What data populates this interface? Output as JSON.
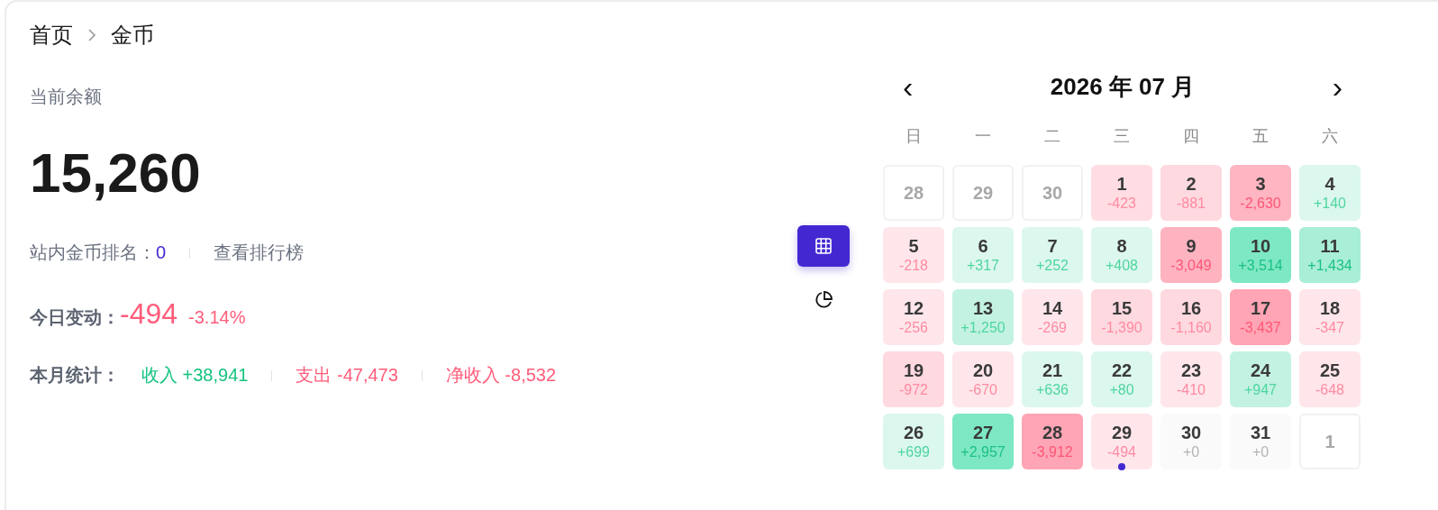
{
  "breadcrumb": [
    {
      "label": "首页"
    },
    {
      "label": "金币"
    }
  ],
  "balance": {
    "label": "当前余额",
    "value": "15,260"
  },
  "rank": {
    "label": "站内金币排名：",
    "value": "0",
    "link": "查看排行榜"
  },
  "today": {
    "label": "今日变动：",
    "value": "-494",
    "percent": "-3.14%"
  },
  "month_stats": {
    "label": "本月统计：",
    "items": [
      {
        "text": "收入 +38,941",
        "kind": "gain"
      },
      {
        "text": "支出 -47,473",
        "kind": "loss"
      },
      {
        "text": "净收入 -8,532",
        "kind": "loss"
      }
    ]
  },
  "view_toggle": [
    {
      "kind": "grid",
      "selected": true
    },
    {
      "kind": "pie",
      "selected": false
    }
  ],
  "calendar": {
    "title": "2026 年 07 月",
    "prev": "‹",
    "next": "›",
    "weekdays": [
      "日",
      "一",
      "二",
      "三",
      "四",
      "五",
      "六"
    ],
    "days": [
      {
        "day": "28",
        "kind": "outside"
      },
      {
        "day": "29",
        "kind": "outside"
      },
      {
        "day": "30",
        "kind": "outside"
      },
      {
        "day": "1",
        "value": "-423",
        "kind": "loss",
        "color": "#ffdde3",
        "today": false
      },
      {
        "day": "2",
        "value": "-881",
        "kind": "loss",
        "color": "#ffd9e0",
        "today": false
      },
      {
        "day": "3",
        "value": "-2,630",
        "kind": "loss",
        "color": "#ffb5c2",
        "today": false
      },
      {
        "day": "4",
        "value": "+140",
        "kind": "gain",
        "color": "#dcf7ee",
        "today": false
      },
      {
        "day": "5",
        "value": "-218",
        "kind": "loss",
        "color": "#ffe6eb",
        "today": false
      },
      {
        "day": "6",
        "value": "+317",
        "kind": "gain",
        "color": "#dcf7ee",
        "today": false
      },
      {
        "day": "7",
        "value": "+252",
        "kind": "gain",
        "color": "#dcf7ee",
        "today": false
      },
      {
        "day": "8",
        "value": "+408",
        "kind": "gain",
        "color": "#dcf7ee",
        "today": false
      },
      {
        "day": "9",
        "value": "-3,049",
        "kind": "loss",
        "color": "#ffb3c0",
        "today": false
      },
      {
        "day": "10",
        "value": "+3,514",
        "kind": "gain",
        "color": "#7ee8c4",
        "today": false
      },
      {
        "day": "11",
        "value": "+1,434",
        "kind": "gain",
        "color": "#a9eed7",
        "today": false
      },
      {
        "day": "12",
        "value": "-256",
        "kind": "loss",
        "color": "#ffe6eb",
        "today": false
      },
      {
        "day": "13",
        "value": "+1,250",
        "kind": "gain",
        "color": "#c3f2e2",
        "today": false
      },
      {
        "day": "14",
        "value": "-269",
        "kind": "loss",
        "color": "#ffe6eb",
        "today": false
      },
      {
        "day": "15",
        "value": "-1,390",
        "kind": "loss",
        "color": "#ffd9e0",
        "today": false
      },
      {
        "day": "16",
        "value": "-1,160",
        "kind": "loss",
        "color": "#ffd9e0",
        "today": false
      },
      {
        "day": "17",
        "value": "-3,437",
        "kind": "loss",
        "color": "#ffa5b5",
        "today": false
      },
      {
        "day": "18",
        "value": "-347",
        "kind": "loss",
        "color": "#ffe6eb",
        "today": false
      },
      {
        "day": "19",
        "value": "-972",
        "kind": "loss",
        "color": "#ffd9e0",
        "today": false
      },
      {
        "day": "20",
        "value": "-670",
        "kind": "loss",
        "color": "#ffe6eb",
        "today": false
      },
      {
        "day": "21",
        "value": "+636",
        "kind": "gain",
        "color": "#dcf7ee",
        "today": false
      },
      {
        "day": "22",
        "value": "+80",
        "kind": "gain",
        "color": "#dcf7ee",
        "today": false
      },
      {
        "day": "23",
        "value": "-410",
        "kind": "loss",
        "color": "#ffe6eb",
        "today": false
      },
      {
        "day": "24",
        "value": "+947",
        "kind": "gain",
        "color": "#c3f2e2",
        "today": false
      },
      {
        "day": "25",
        "value": "-648",
        "kind": "loss",
        "color": "#ffe6eb",
        "today": false
      },
      {
        "day": "26",
        "value": "+699",
        "kind": "gain",
        "color": "#dcf7ee",
        "today": false
      },
      {
        "day": "27",
        "value": "+2,957",
        "kind": "gain",
        "color": "#7ee8c4",
        "today": false
      },
      {
        "day": "28",
        "value": "-3,912",
        "kind": "loss",
        "color": "#ffa5b5",
        "today": false
      },
      {
        "day": "29",
        "value": "-494",
        "kind": "loss",
        "color": "#ffe6eb",
        "today": true
      },
      {
        "day": "30",
        "value": "+0",
        "kind": "zero",
        "color": "#fafafa",
        "today": false
      },
      {
        "day": "31",
        "value": "+0",
        "kind": "zero",
        "color": "#fafafa",
        "today": false
      },
      {
        "day": "1",
        "kind": "outside"
      }
    ]
  }
}
